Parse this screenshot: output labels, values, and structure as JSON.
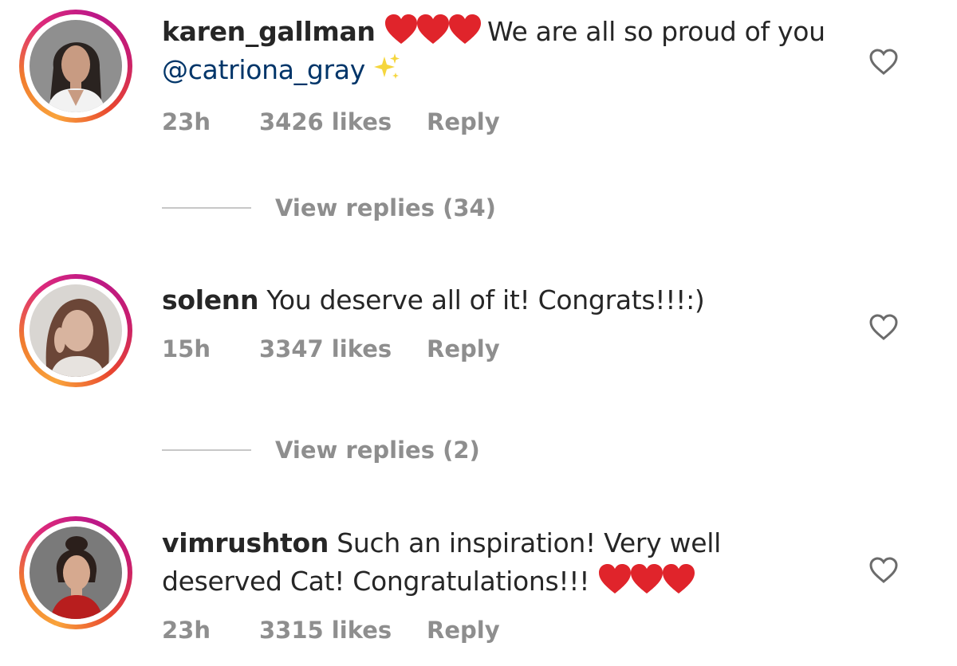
{
  "comments": [
    {
      "username": "karen_gallman",
      "text_after_hearts": " We are all so proud of you ",
      "mention": "@catriona_gray",
      "time": "23h",
      "likes": "3426 likes",
      "reply_label": "Reply",
      "view_replies": "View replies (34)",
      "avatar_colors": {
        "bg": "#8f8f8f",
        "hair": "#2a2320",
        "skin": "#c89b82",
        "top": "#f2f2f2"
      }
    },
    {
      "username": "solenn",
      "text": " You deserve all of it! Congrats!!!:)",
      "time": "15h",
      "likes": "3347 likes",
      "reply_label": "Reply",
      "view_replies": "View replies (2)",
      "avatar_colors": {
        "bg": "#d9d6d2",
        "hair": "#6b4637",
        "skin": "#d8b49f",
        "top": "#e7e3df"
      }
    },
    {
      "username": "vimrushton",
      "text": " Such an inspiration! Very well deserved Cat! Congratulations!!! ",
      "time": "23h",
      "likes": "3315 likes",
      "reply_label": "Reply",
      "avatar_colors": {
        "bg": "#7a7a7a",
        "hair": "#2b1f1b",
        "skin": "#d6a98f",
        "top": "#b81e1e"
      }
    }
  ],
  "icons": {
    "like": "heart-outline-icon",
    "emoji_heart": "red-heart-emoji",
    "emoji_sparkle": "sparkles-emoji"
  },
  "colors": {
    "text": "#262626",
    "muted": "#8e8e8e",
    "mention": "#003569",
    "emoji_red": "#e0242b",
    "sparkle_yellow": "#f5d63d"
  }
}
